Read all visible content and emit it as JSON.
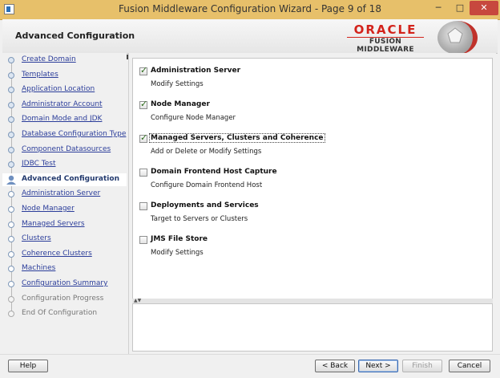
{
  "window": {
    "title": "Fusion Middleware Configuration Wizard - Page 9 of 18",
    "min_glyph": "─",
    "max_glyph": "□",
    "close_glyph": "✕"
  },
  "header": {
    "page_title": "Advanced Configuration",
    "brand_top": "ORACLE",
    "brand_bottom": "FUSION MIDDLEWARE",
    "brand_color": "#d3231b"
  },
  "nav": {
    "items": [
      {
        "label": "Create Domain",
        "state": "done"
      },
      {
        "label": "Templates",
        "state": "done"
      },
      {
        "label": "Application Location",
        "state": "done"
      },
      {
        "label": "Administrator Account",
        "state": "done"
      },
      {
        "label": "Domain Mode and JDK",
        "state": "done"
      },
      {
        "label": "Database Configuration Type",
        "state": "done"
      },
      {
        "label": "Component Datasources",
        "state": "done"
      },
      {
        "label": "JDBC Test",
        "state": "done"
      },
      {
        "label": "Advanced Configuration",
        "state": "current"
      },
      {
        "label": "Administration Server",
        "state": "link"
      },
      {
        "label": "Node Manager",
        "state": "link"
      },
      {
        "label": "Managed Servers",
        "state": "link"
      },
      {
        "label": "Clusters",
        "state": "link"
      },
      {
        "label": "Coherence Clusters",
        "state": "link"
      },
      {
        "label": "Machines",
        "state": "link"
      },
      {
        "label": "Configuration Summary",
        "state": "link"
      },
      {
        "label": "Configuration Progress",
        "state": "disabled"
      },
      {
        "label": "End Of Configuration",
        "state": "disabled"
      }
    ]
  },
  "options": [
    {
      "title": "Administration Server",
      "desc": "Modify Settings",
      "checked": true
    },
    {
      "title": "Node Manager",
      "desc": "Configure Node Manager",
      "checked": true
    },
    {
      "title": "Managed Servers, Clusters and Coherence",
      "desc": "Add or Delete or Modify Settings",
      "checked": true
    },
    {
      "title": "Domain Frontend Host Capture",
      "desc": "Configure Domain Frontend Host",
      "checked": false
    },
    {
      "title": "Deployments and Services",
      "desc": "Target to Servers or Clusters",
      "checked": false
    },
    {
      "title": "JMS File Store",
      "desc": "Modify Settings",
      "checked": false
    }
  ],
  "footer": {
    "help": "Help",
    "back": "< Back",
    "next": "Next >",
    "finish": "Finish",
    "cancel": "Cancel"
  }
}
